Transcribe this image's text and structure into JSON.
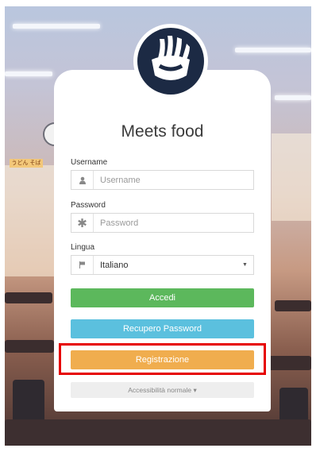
{
  "app": {
    "title": "Meets food"
  },
  "form": {
    "username": {
      "label": "Username",
      "placeholder": "Username",
      "icon": "user-icon"
    },
    "password": {
      "label": "Password",
      "placeholder": "Password",
      "icon": "asterisk-icon"
    },
    "language": {
      "label": "Lingua",
      "selected": "Italiano",
      "icon": "flag-icon"
    }
  },
  "buttons": {
    "login": "Accedi",
    "recover_password": "Recupero Password",
    "register": "Registrazione",
    "accessibility": "Accessibilità normale ▾"
  },
  "background": {
    "sign_text": "うどん そば"
  },
  "colors": {
    "accent_green": "#5cb85c",
    "accent_blue": "#5bc0de",
    "accent_orange": "#f0ad4e",
    "highlight_red": "#e60000",
    "logo_navy": "#1c2a44"
  }
}
